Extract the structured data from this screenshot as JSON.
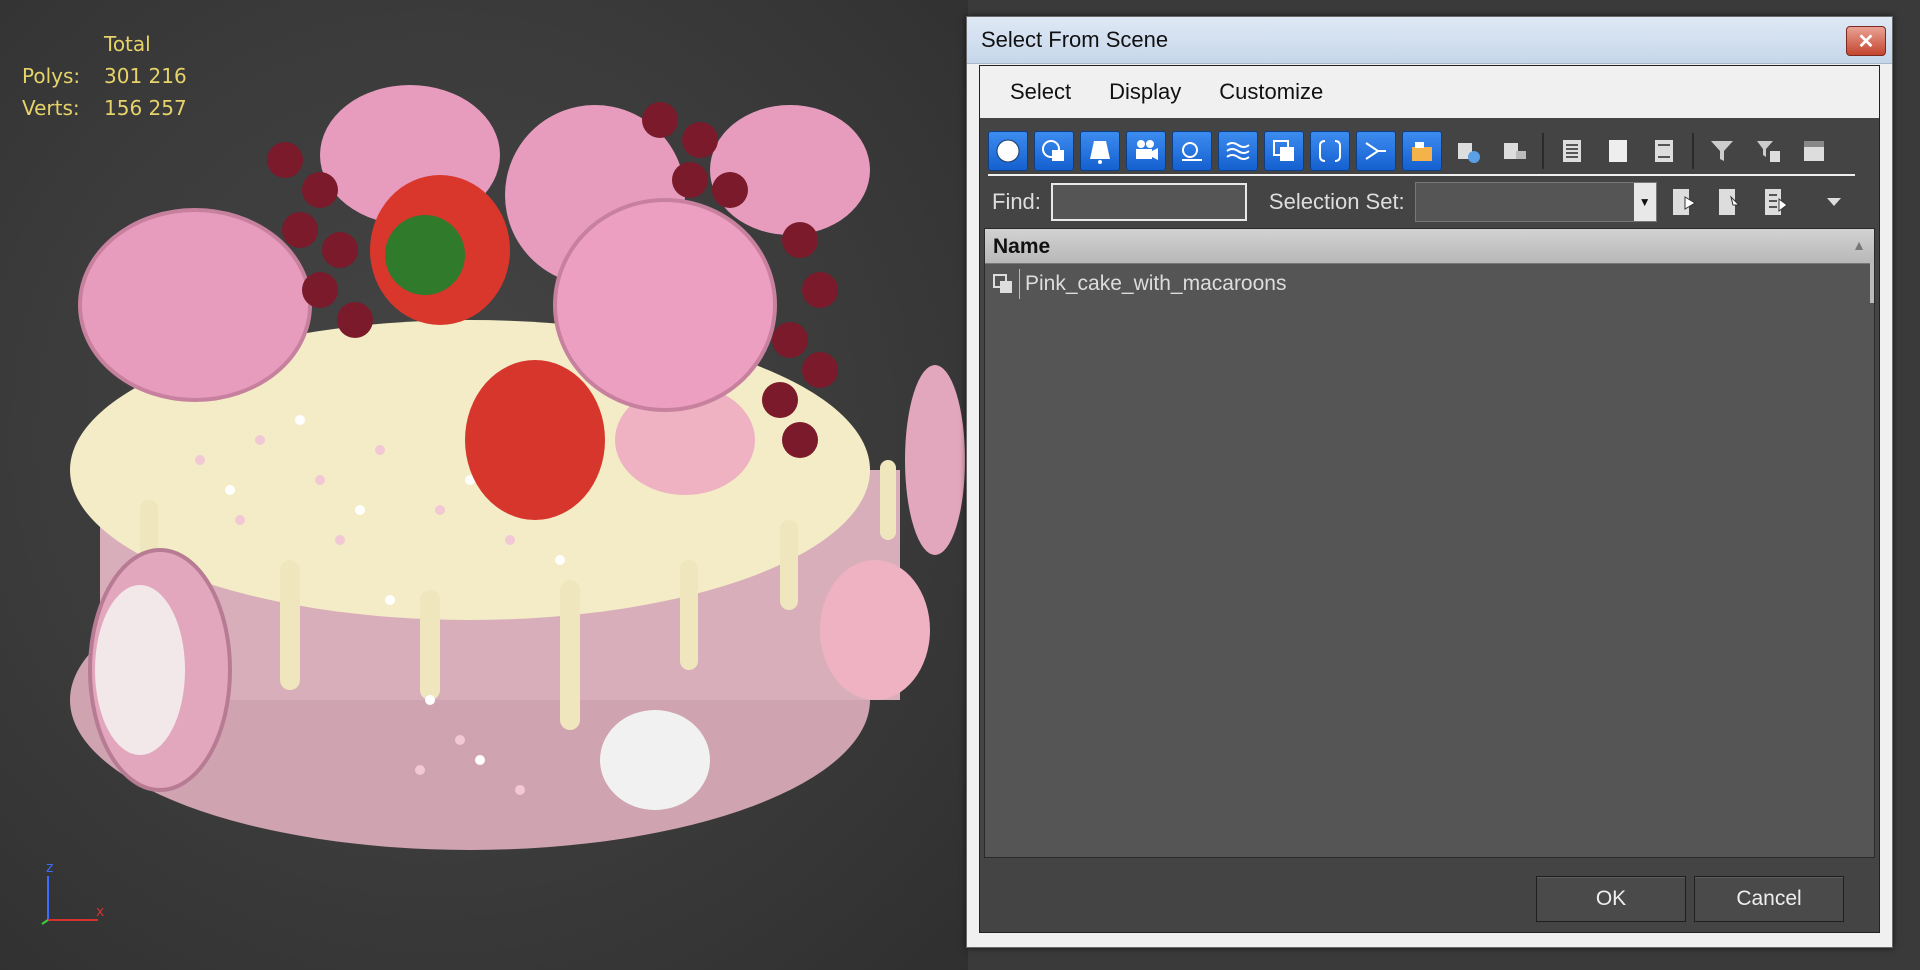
{
  "viewport": {
    "stats": {
      "total_label": "Total",
      "polys_label": "Polys:",
      "polys_value": "301 216",
      "verts_label": "Verts:",
      "verts_value": "156 257"
    },
    "axis": {
      "z_label": "z",
      "x_label": "x"
    }
  },
  "dialog": {
    "title": "Select From Scene",
    "close_symbol": "✕",
    "menu": [
      "Select",
      "Display",
      "Customize"
    ],
    "toolbar_icons": [
      {
        "name": "geometry-filter-icon",
        "on": true
      },
      {
        "name": "shapes-filter-icon",
        "on": true
      },
      {
        "name": "lights-filter-icon",
        "on": true
      },
      {
        "name": "cameras-filter-icon",
        "on": true
      },
      {
        "name": "helpers-filter-icon",
        "on": true
      },
      {
        "name": "spacewarps-filter-icon",
        "on": true
      },
      {
        "name": "groups-filter-icon",
        "on": true
      },
      {
        "name": "xrefs-filter-icon",
        "on": true
      },
      {
        "name": "bones-filter-icon",
        "on": true
      },
      {
        "name": "containers-filter-icon",
        "on": true
      },
      {
        "name": "frozen-objects-icon",
        "on": false
      },
      {
        "name": "hidden-objects-icon",
        "on": false
      }
    ],
    "find_label": "Find:",
    "find_value": "",
    "selection_set_label": "Selection Set:",
    "selection_set_value": "",
    "list": {
      "column_header": "Name",
      "rows": [
        "Pink_cake_with_macaroons"
      ]
    },
    "ok_label": "OK",
    "cancel_label": "Cancel",
    "colors": {
      "toggle_on": "#1f6fe0",
      "viewport_stats": "#e6d36a",
      "panel_bg": "#444444"
    }
  }
}
